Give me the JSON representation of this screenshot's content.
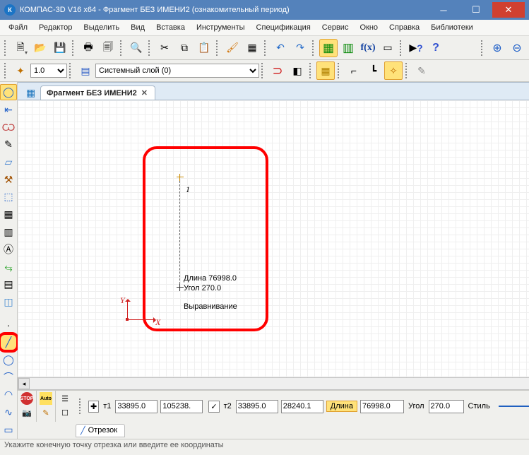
{
  "title": "КОМПАС-3D V16  x64 - Фрагмент БЕЗ ИМЕНИ2 (ознакомительный период)",
  "menu": [
    "Файл",
    "Редактор",
    "Выделить",
    "Вид",
    "Вставка",
    "Инструменты",
    "Спецификация",
    "Сервис",
    "Окно",
    "Справка",
    "Библиотеки"
  ],
  "toolbar1": {
    "new": "☐",
    "open": "📂",
    "save": "💾",
    "print": "🖶",
    "preview": "🗐",
    "cut": "✂",
    "copy": "⧉",
    "paste": "📋",
    "brush": "🖌",
    "props": "▦",
    "undo": "↶",
    "redo": "↷"
  },
  "toolbar1_green": [
    "▦",
    "▥"
  ],
  "toolbar1_fx": "f(x)",
  "toolbar1_vars": "☒",
  "toolbar1_right": {
    "what": "▶?",
    "help": "❓"
  },
  "views": {
    "zoom_in": "🔍+",
    "zoom_out": "🔍−"
  },
  "toolbar2": {
    "scale_options": [
      "1.0"
    ],
    "scale": "1.0",
    "layer_icon": "▤",
    "layer": "Системный слой (0)",
    "magnet": "🧲",
    "grid": "▦",
    "ortho": "⌐",
    "local": "┗",
    "dyn": "✧"
  },
  "tab": {
    "label": "Фрагмент БЕЗ ИМЕНИ2"
  },
  "canvas": {
    "point_label": "1",
    "tip_line1": "Длина 76998.0",
    "tip_line2": "Угол 270.0",
    "align": "Выравнивание",
    "axis_x": "X",
    "axis_y": "Y"
  },
  "props": {
    "stop": "STOP",
    "auto": "Auto",
    "t1_icon": "✚",
    "t1_lbl": "т1",
    "t1x": "33895.0",
    "t1y": "105238.",
    "t2_icon": "✓",
    "t2_lbl": "т2",
    "t2x": "33895.0",
    "t2y": "28240.1",
    "len_lbl": "Длина",
    "len": "76998.0",
    "ang_lbl": "Угол",
    "ang": "270.0",
    "style_lbl": "Стиль",
    "cam": "📷",
    "pencil": "✎",
    "doc": "☐",
    "segment": "Отрезок",
    "seg_icon": "╱"
  },
  "status": "Укажите конечную точку отрезка или введите ее координаты"
}
